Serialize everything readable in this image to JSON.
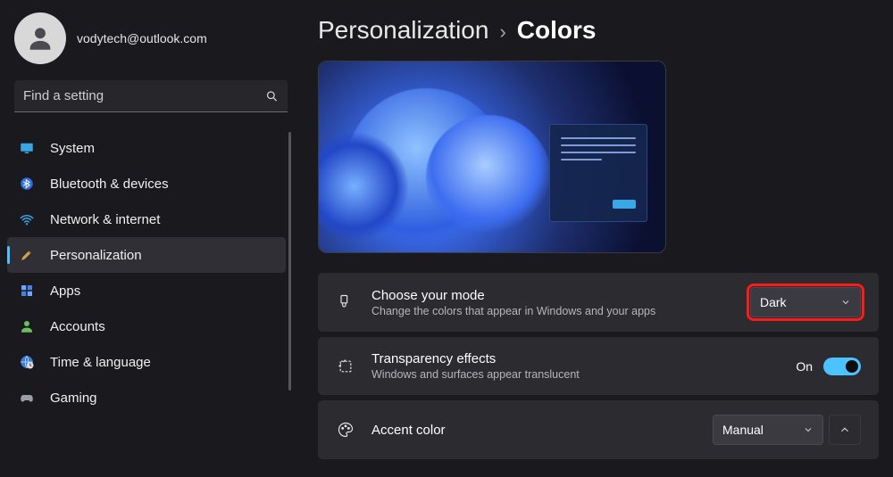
{
  "user": {
    "email": "vodytech@outlook.com"
  },
  "search": {
    "placeholder": "Find a setting"
  },
  "sidebar": {
    "items": [
      {
        "label": "System",
        "icon": "display-icon"
      },
      {
        "label": "Bluetooth & devices",
        "icon": "bluetooth-icon"
      },
      {
        "label": "Network & internet",
        "icon": "wifi-icon"
      },
      {
        "label": "Personalization",
        "icon": "brush-icon",
        "active": true
      },
      {
        "label": "Apps",
        "icon": "apps-icon"
      },
      {
        "label": "Accounts",
        "icon": "person-icon"
      },
      {
        "label": "Time & language",
        "icon": "globe-clock-icon"
      },
      {
        "label": "Gaming",
        "icon": "gamepad-icon"
      }
    ]
  },
  "breadcrumb": {
    "parent": "Personalization",
    "separator": "›",
    "current": "Colors"
  },
  "settings": {
    "mode": {
      "title": "Choose your mode",
      "subtitle": "Change the colors that appear in Windows and your apps",
      "value": "Dark",
      "highlighted": true
    },
    "transparency": {
      "title": "Transparency effects",
      "subtitle": "Windows and surfaces appear translucent",
      "state_label": "On",
      "value": true
    },
    "accent": {
      "title": "Accent color",
      "value": "Manual"
    }
  },
  "colors": {
    "accent": "#4cc2ff",
    "highlight_outline": "#ff1a1a"
  }
}
